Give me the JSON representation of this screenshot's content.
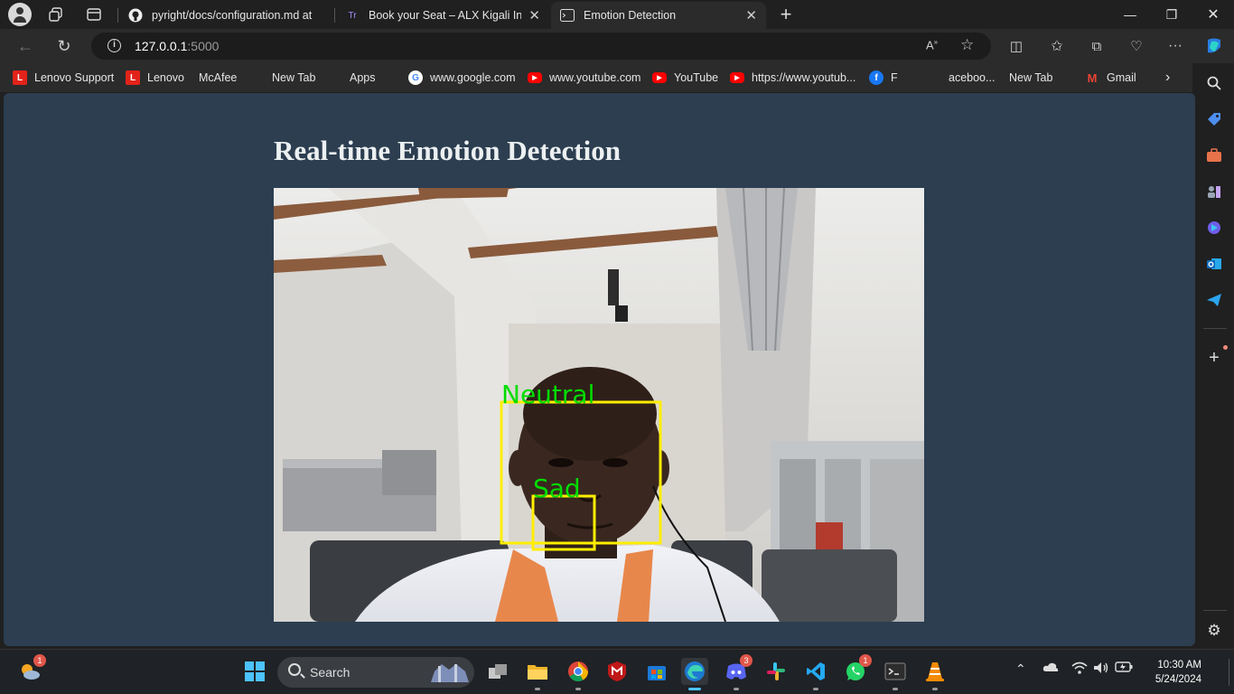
{
  "browser": {
    "tabs": [
      {
        "title": "pyright/docs/configuration.md at",
        "favicon": "github-icon"
      },
      {
        "title": "Book your Seat – ALX Kigali In Hu",
        "favicon": "alx-icon"
      },
      {
        "title": "Emotion Detection",
        "favicon": "terminal-icon",
        "active": true
      }
    ],
    "address": {
      "host": "127.0.0.1",
      "port": ":5000"
    },
    "bookmarks": [
      {
        "label": "Lenovo Support",
        "icon": "lenovo-icon"
      },
      {
        "label": "Lenovo",
        "icon": "lenovo-icon"
      },
      {
        "label": "McAfee",
        "icon": "page-icon"
      },
      {
        "label": "New Tab",
        "icon": "page-icon"
      },
      {
        "label": "Apps",
        "icon": "page-icon"
      },
      {
        "label": "www.google.com",
        "icon": "google-icon"
      },
      {
        "label": "www.youtube.com",
        "icon": "youtube-icon"
      },
      {
        "label": "YouTube",
        "icon": "youtube-icon"
      },
      {
        "label": "https://www.youtub...",
        "icon": "youtube-icon"
      },
      {
        "label": "F",
        "icon": "facebook-icon"
      },
      {
        "label": "aceboo...",
        "icon": ""
      },
      {
        "label": "New Tab",
        "icon": "page-icon"
      },
      {
        "label": "Gmail",
        "icon": "gmail-icon"
      }
    ]
  },
  "page": {
    "heading": "Real-time Emotion Detection",
    "video": {
      "detections": [
        {
          "label": "Neutral",
          "color": "#00dd00",
          "box_color": "#ffee00"
        },
        {
          "label": "Sad",
          "color": "#00dd00",
          "box_color": "#ffee00"
        }
      ]
    }
  },
  "taskbar": {
    "search_label": "Search",
    "weather_badge": "1",
    "discord_badge": "3",
    "whatsapp_badge": "1",
    "time": "10:30 AM",
    "date": "5/24/2024"
  },
  "colors": {
    "page_bg": "#2c3e50",
    "heading": "#ecf0f1",
    "detection_label": "#00dd00",
    "detection_box": "#ffee00",
    "active_indicator": "#4cc2ff"
  }
}
